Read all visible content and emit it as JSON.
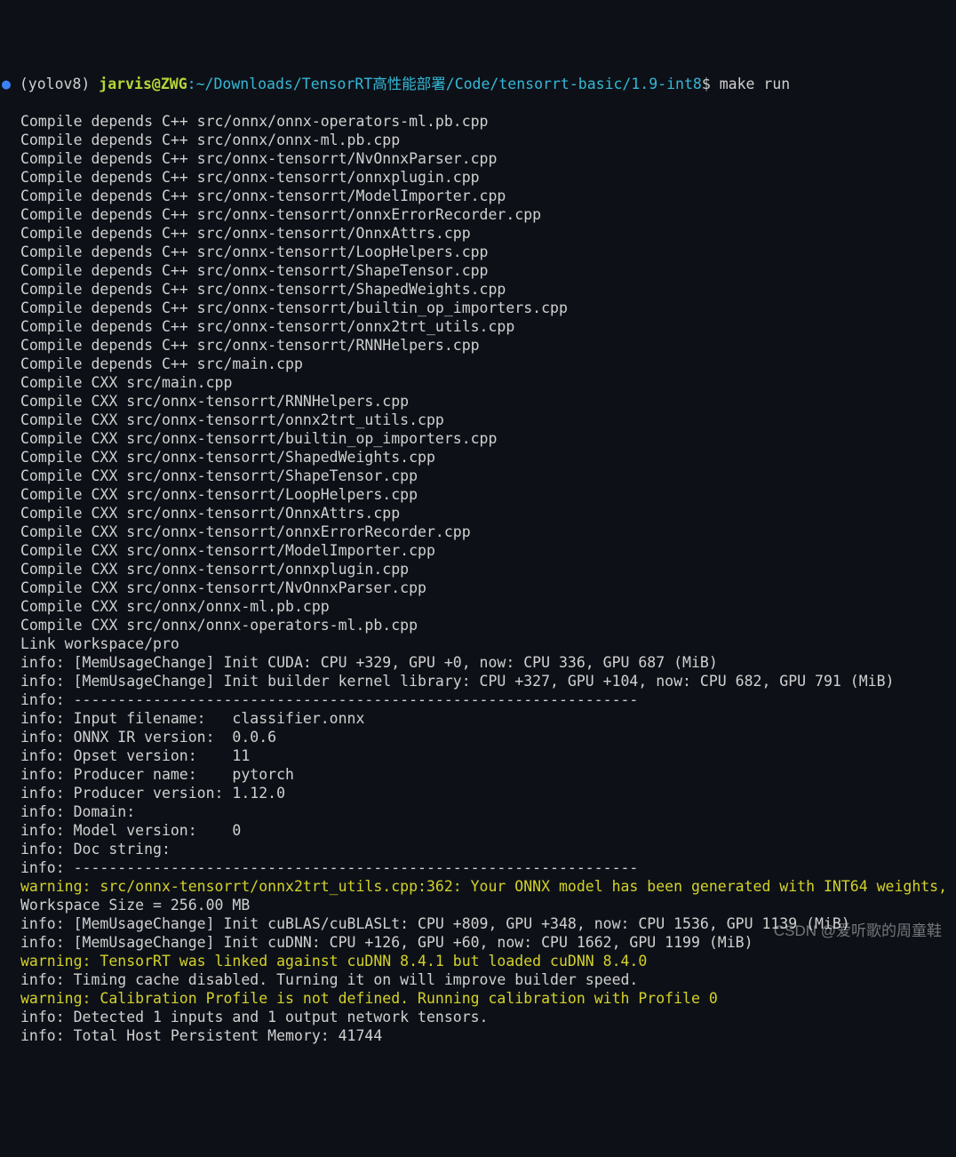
{
  "prompt": {
    "bullet": "●",
    "env": "(yolov8)",
    "userhost": "jarvis@ZWG",
    "colon": ":",
    "path": "~/Downloads/TensorRT高性能部署/Code/tensorrt-basic/1.9-int8",
    "dollar": "$",
    "command": "make run"
  },
  "lines": [
    {
      "t": "out",
      "text": "Compile depends C++ src/onnx/onnx-operators-ml.pb.cpp"
    },
    {
      "t": "out",
      "text": "Compile depends C++ src/onnx/onnx-ml.pb.cpp"
    },
    {
      "t": "out",
      "text": "Compile depends C++ src/onnx-tensorrt/NvOnnxParser.cpp"
    },
    {
      "t": "out",
      "text": "Compile depends C++ src/onnx-tensorrt/onnxplugin.cpp"
    },
    {
      "t": "out",
      "text": "Compile depends C++ src/onnx-tensorrt/ModelImporter.cpp"
    },
    {
      "t": "out",
      "text": "Compile depends C++ src/onnx-tensorrt/onnxErrorRecorder.cpp"
    },
    {
      "t": "out",
      "text": "Compile depends C++ src/onnx-tensorrt/OnnxAttrs.cpp"
    },
    {
      "t": "out",
      "text": "Compile depends C++ src/onnx-tensorrt/LoopHelpers.cpp"
    },
    {
      "t": "out",
      "text": "Compile depends C++ src/onnx-tensorrt/ShapeTensor.cpp"
    },
    {
      "t": "out",
      "text": "Compile depends C++ src/onnx-tensorrt/ShapedWeights.cpp"
    },
    {
      "t": "out",
      "text": "Compile depends C++ src/onnx-tensorrt/builtin_op_importers.cpp"
    },
    {
      "t": "out",
      "text": "Compile depends C++ src/onnx-tensorrt/onnx2trt_utils.cpp"
    },
    {
      "t": "out",
      "text": "Compile depends C++ src/onnx-tensorrt/RNNHelpers.cpp"
    },
    {
      "t": "out",
      "text": "Compile depends C++ src/main.cpp"
    },
    {
      "t": "out",
      "text": "Compile CXX src/main.cpp"
    },
    {
      "t": "out",
      "text": "Compile CXX src/onnx-tensorrt/RNNHelpers.cpp"
    },
    {
      "t": "out",
      "text": "Compile CXX src/onnx-tensorrt/onnx2trt_utils.cpp"
    },
    {
      "t": "out",
      "text": "Compile CXX src/onnx-tensorrt/builtin_op_importers.cpp"
    },
    {
      "t": "out",
      "text": "Compile CXX src/onnx-tensorrt/ShapedWeights.cpp"
    },
    {
      "t": "out",
      "text": "Compile CXX src/onnx-tensorrt/ShapeTensor.cpp"
    },
    {
      "t": "out",
      "text": "Compile CXX src/onnx-tensorrt/LoopHelpers.cpp"
    },
    {
      "t": "out",
      "text": "Compile CXX src/onnx-tensorrt/OnnxAttrs.cpp"
    },
    {
      "t": "out",
      "text": "Compile CXX src/onnx-tensorrt/onnxErrorRecorder.cpp"
    },
    {
      "t": "out",
      "text": "Compile CXX src/onnx-tensorrt/ModelImporter.cpp"
    },
    {
      "t": "out",
      "text": "Compile CXX src/onnx-tensorrt/onnxplugin.cpp"
    },
    {
      "t": "out",
      "text": "Compile CXX src/onnx-tensorrt/NvOnnxParser.cpp"
    },
    {
      "t": "out",
      "text": "Compile CXX src/onnx/onnx-ml.pb.cpp"
    },
    {
      "t": "out",
      "text": "Compile CXX src/onnx/onnx-operators-ml.pb.cpp"
    },
    {
      "t": "out",
      "text": "Link workspace/pro"
    },
    {
      "t": "out",
      "text": "info: [MemUsageChange] Init CUDA: CPU +329, GPU +0, now: CPU 336, GPU 687 (MiB)"
    },
    {
      "t": "out",
      "text": "info: [MemUsageChange] Init builder kernel library: CPU +327, GPU +104, now: CPU 682, GPU 791 (MiB)"
    },
    {
      "t": "out",
      "text": "info: ----------------------------------------------------------------"
    },
    {
      "t": "out",
      "text": "info: Input filename:   classifier.onnx"
    },
    {
      "t": "out",
      "text": "info: ONNX IR version:  0.0.6"
    },
    {
      "t": "out",
      "text": "info: Opset version:    11"
    },
    {
      "t": "out",
      "text": "info: Producer name:    pytorch"
    },
    {
      "t": "out",
      "text": "info: Producer version: 1.12.0"
    },
    {
      "t": "out",
      "text": "info: Domain:           "
    },
    {
      "t": "out",
      "text": "info: Model version:    0"
    },
    {
      "t": "out",
      "text": "info: Doc string:       "
    },
    {
      "t": "out",
      "text": "info: ----------------------------------------------------------------"
    },
    {
      "t": "warn",
      "text": "warning: src/onnx-tensorrt/onnx2trt_utils.cpp:362: Your ONNX model has been generated with INT64 weights,"
    },
    {
      "t": "out",
      "text": "Workspace Size = 256.00 MB"
    },
    {
      "t": "out",
      "text": "info: [MemUsageChange] Init cuBLAS/cuBLASLt: CPU +809, GPU +348, now: CPU 1536, GPU 1139 (MiB)"
    },
    {
      "t": "out",
      "text": "info: [MemUsageChange] Init cuDNN: CPU +126, GPU +60, now: CPU 1662, GPU 1199 (MiB)"
    },
    {
      "t": "warn",
      "text": "warning: TensorRT was linked against cuDNN 8.4.1 but loaded cuDNN 8.4.0"
    },
    {
      "t": "out",
      "text": "info: Timing cache disabled. Turning it on will improve builder speed."
    },
    {
      "t": "warn",
      "text": "warning: Calibration Profile is not defined. Running calibration with Profile 0"
    },
    {
      "t": "out",
      "text": "info: Detected 1 inputs and 1 output network tensors."
    },
    {
      "t": "out",
      "text": "info: Total Host Persistent Memory: 41744"
    }
  ],
  "watermark": "CSDN @爱听歌的周童鞋"
}
